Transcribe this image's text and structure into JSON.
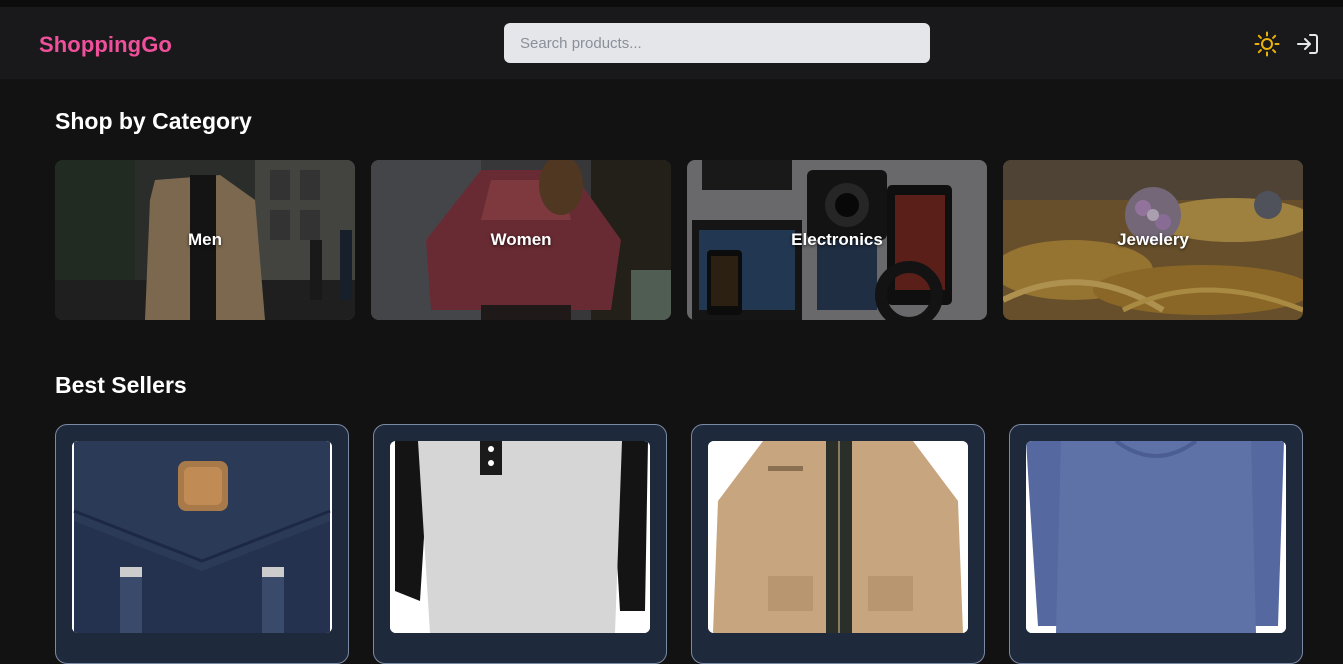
{
  "app": {
    "brand": "ShoppingGo"
  },
  "header": {
    "search_placeholder": "Search products...",
    "search_value": "",
    "theme_icon": "sun-icon",
    "login_icon": "login-icon"
  },
  "colors": {
    "brand": "#f0509b",
    "background": "#121213",
    "header_bg": "#19191b",
    "card_bg": "#1e293b",
    "card_border": "#7b8aa4",
    "sun_icon": "#eab308"
  },
  "categories_section": {
    "title": "Shop by Category",
    "items": [
      {
        "label": "Men"
      },
      {
        "label": "Women"
      },
      {
        "label": "Electronics"
      },
      {
        "label": "Jewelery"
      }
    ]
  },
  "best_sellers": {
    "title": "Best Sellers",
    "items": [
      {
        "image": "navy-backpack"
      },
      {
        "image": "raglan-henley-shirt"
      },
      {
        "image": "khaki-jacket"
      },
      {
        "image": "blue-long-sleeve-tee"
      }
    ]
  }
}
